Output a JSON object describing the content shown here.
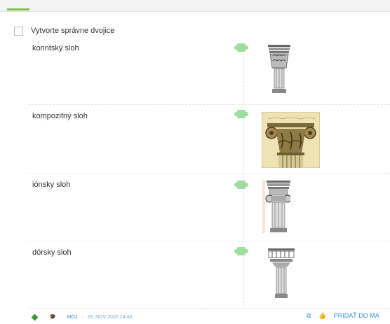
{
  "task": {
    "title": "Vytvorte správne dvojice"
  },
  "pairs": [
    {
      "label": "korintský sloh",
      "image": "corinthian-column-icon"
    },
    {
      "label": "kompozitný sloh",
      "image": "composite-capital-image"
    },
    {
      "label": "iónsky sloh",
      "image": "ionic-column-icon"
    },
    {
      "label": "dórsky sloh",
      "image": "doric-column-icon"
    }
  ],
  "footer": {
    "dot1": "·",
    "dot2": "·",
    "dot3": "·",
    "owner": "MÔJ",
    "date": "29. NOV 2020 14:40",
    "add_label": "PRIDAŤ DO MA"
  },
  "colors": {
    "accent": "#7ec34b",
    "link": "#3a8fd0",
    "puzzle": "#9fdc9f"
  }
}
